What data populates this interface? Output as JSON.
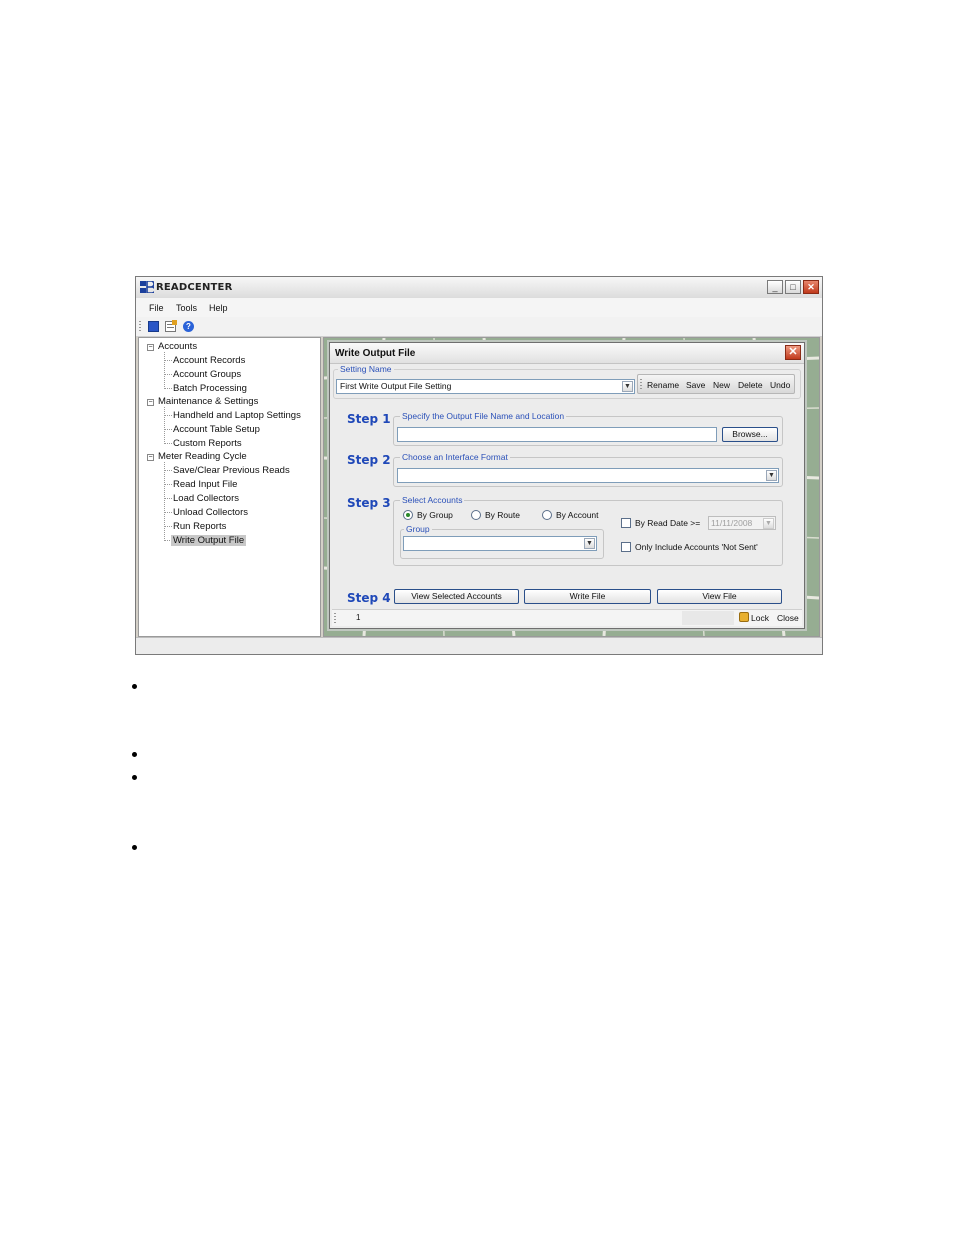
{
  "app": {
    "title": "READCENTER",
    "window_buttons": {
      "minimize": "_",
      "maximize": "□",
      "close": "✕"
    }
  },
  "menu": [
    "File",
    "Tools",
    "Help"
  ],
  "toolbar": {
    "icons": [
      "stop-icon",
      "report-icon",
      "help-icon"
    ]
  },
  "tree": {
    "accounts": {
      "label": "Accounts",
      "children": [
        "Account Records",
        "Account Groups",
        "Batch Processing"
      ]
    },
    "maintenance": {
      "label": "Maintenance & Settings",
      "children": [
        "Handheld and Laptop Settings",
        "Account Table Setup",
        "Custom Reports"
      ]
    },
    "cycle": {
      "label": "Meter Reading Cycle",
      "children": [
        "Save/Clear Previous Reads",
        "Read Input File",
        "Load Collectors",
        "Unload Collectors",
        "Run Reports",
        "Write Output File"
      ]
    },
    "selected": "Write Output File"
  },
  "dialog": {
    "title": "Write Output File",
    "setting_name": {
      "legend": "Setting Name",
      "value": "First Write Output File Setting",
      "commands": [
        "Rename",
        "Save",
        "New",
        "Delete",
        "Undo"
      ]
    },
    "step1": {
      "label": "Step 1",
      "legend": "Specify the Output File Name and Location",
      "value": "",
      "browse": "Browse..."
    },
    "step2": {
      "label": "Step 2",
      "legend": "Choose an Interface Format",
      "value": ""
    },
    "step3": {
      "label": "Step 3",
      "legend": "Select Accounts",
      "options": [
        "By Group",
        "By Route",
        "By Account"
      ],
      "selected_option": "By Group",
      "group_legend": "Group",
      "group_value": "",
      "by_read_date_label": "By Read Date >=",
      "by_read_date_checked": false,
      "read_date": "11/11/2008",
      "not_sent_label": "Only Include Accounts 'Not Sent'",
      "not_sent_checked": false
    },
    "step4": {
      "label": "Step 4",
      "buttons": [
        "View Selected Accounts",
        "Write File",
        "View File"
      ]
    },
    "status": {
      "page": "1",
      "lock": "Lock",
      "close": "Close"
    }
  }
}
